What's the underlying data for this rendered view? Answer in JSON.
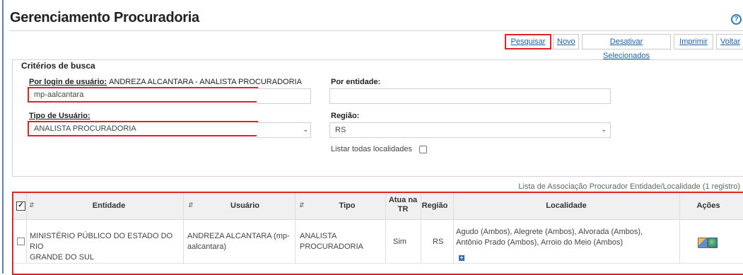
{
  "page": {
    "title": "Gerenciamento Procuradoria"
  },
  "toolbar": {
    "pesquisar": "Pesquisar",
    "novo": "Novo",
    "desativar": "Desativar Selecionados",
    "imprimir": "Imprimir",
    "voltar": "Voltar"
  },
  "search": {
    "legend": "Critérios de busca",
    "login_label": "Por login de usuário:",
    "login_user_display": "ANDREZA ALCANTARA - ANALISTA PROCURADORIA",
    "login_value": "mp-aalcantara",
    "entidade_label": "Por entidade:",
    "entidade_value": "",
    "tipo_label": "Tipo de Usuário:",
    "tipo_value": "ANALISTA PROCURADORIA",
    "regiao_label": "Região:",
    "regiao_value": "RS",
    "listar_label": "Listar todas localidades",
    "listar_checked": false
  },
  "list": {
    "caption": "Lista de Associação Procurador Entidade/Localidade (1 registro)",
    "headers": {
      "entidade": "Entidade",
      "usuario": "Usuário",
      "tipo": "Tipo",
      "atua_line1": "Atua na",
      "atua_line2": "TR",
      "regiao": "Região",
      "localidade": "Localidade",
      "acoes": "Ações"
    },
    "row": {
      "entidade_1": "MINISTÉRIO PÚBLICO DO ESTADO DO RIO",
      "entidade_2": "GRANDE DO SUL",
      "usuario_1": "ANDREZA ALCANTARA (mp-",
      "usuario_2": "aalcantara)",
      "tipo_1": "ANALISTA",
      "tipo_2": "PROCURADORIA",
      "atua": "Sim",
      "regiao": "RS",
      "localidade_1": "Agudo (Ambos), Alegrete (Ambos), Alvorada (Ambos),",
      "localidade_2": "Antônio Prado (Ambos), Arroio do Meio (Ambos)"
    }
  },
  "icons": {
    "help": "help-icon",
    "sort": "sort-icon",
    "expand": "plus-icon",
    "edit": "edit-icon",
    "localities": "globe-icon"
  },
  "colors": {
    "highlight": "#e02424",
    "link": "#1f5fa8",
    "header_bg": "#f0f0f0"
  }
}
